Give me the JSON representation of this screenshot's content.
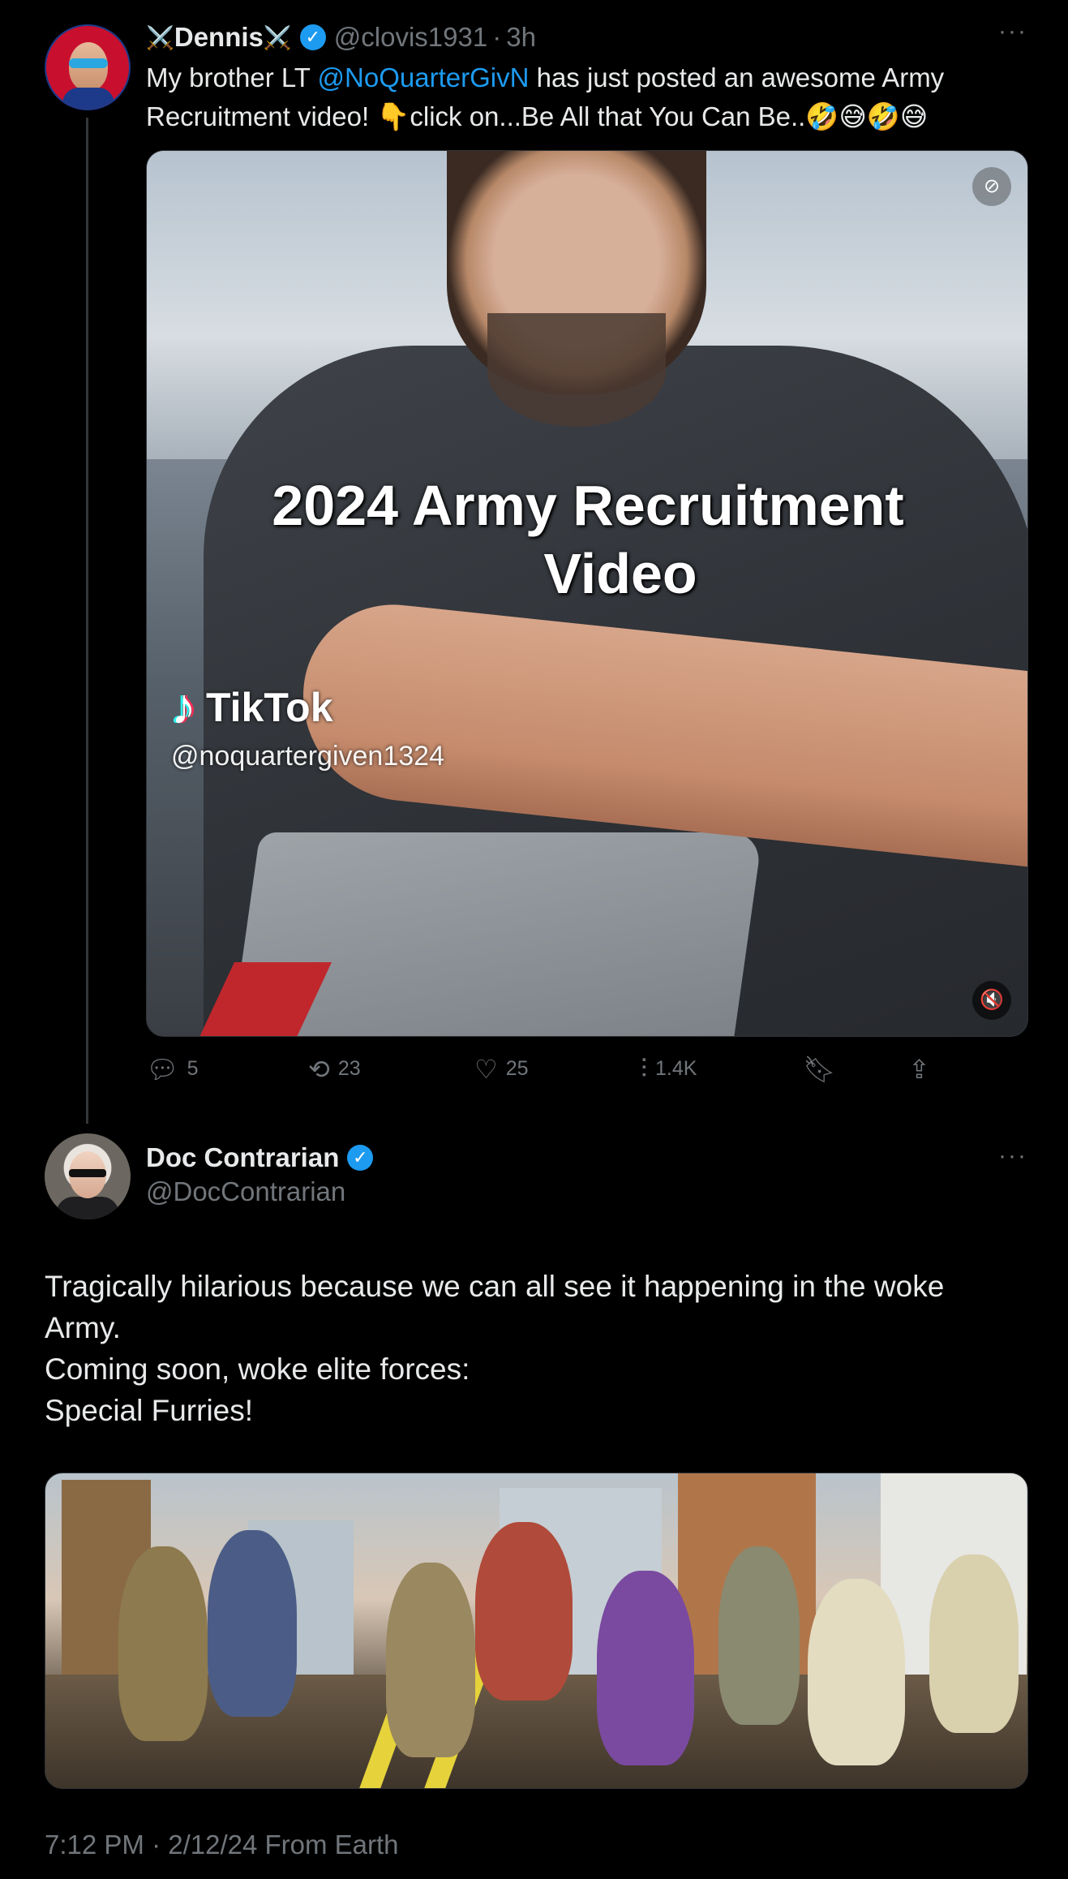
{
  "tweet1": {
    "swords_left": "⚔️",
    "name": "Dennis",
    "swords_right": "⚔️",
    "handle": "@clovis1931",
    "separator": "·",
    "time": "3h",
    "more": "···",
    "text_before": "My brother LT ",
    "mention": "@NoQuarterGivN",
    "text_after": " has just posted an awesome Army Recruitment video!  👇click on...Be All that You Can Be..🤣😅🤣😅",
    "video": {
      "title_line1": "2024 Army Recruitment",
      "title_line2": "Video",
      "tiktok_brand": "TikTok",
      "tiktok_handle": "@noquartergiven1324",
      "top_icon": "caption-off-icon",
      "bottom_icon": "mute-icon"
    },
    "actions": {
      "replies": "5",
      "reposts": "23",
      "likes": "25",
      "views": "1.4K"
    }
  },
  "tweet2": {
    "name": "Doc Contrarian",
    "handle": "@DocContrarian",
    "more": "···",
    "lines": [
      "Tragically hilarious because we can all see it happening in the woke Army.",
      "Coming soon, woke elite forces:",
      "Special Furries!"
    ],
    "timestamp": "7:12 PM · 2/12/24 From Earth"
  },
  "colors": {
    "background": "#000000",
    "text": "#e7e9ea",
    "muted": "#71767b",
    "accent": "#1d9bf0"
  }
}
